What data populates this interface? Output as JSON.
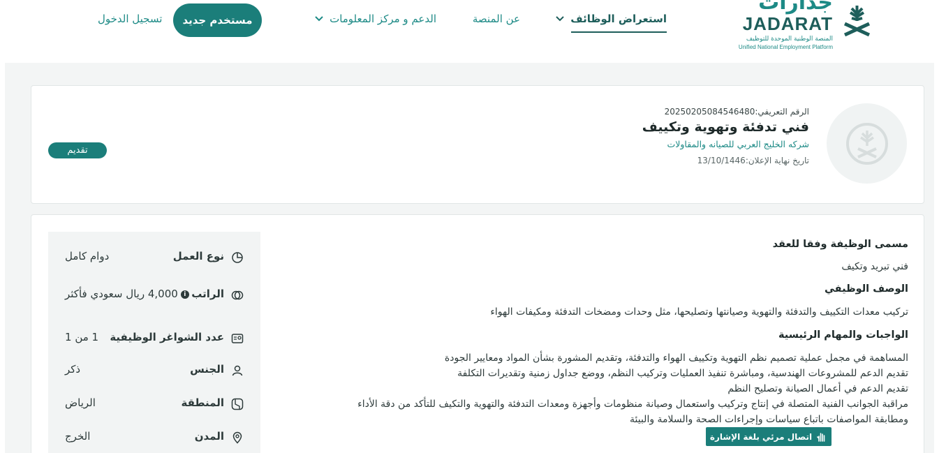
{
  "brand": {
    "name_ar": "جدارات",
    "name_en": "JADARAT",
    "subtitle_ar": "المنصة الوطنية الموحدة للتوظيف",
    "subtitle_en": "Unified National Employment Platform"
  },
  "nav": {
    "browse_jobs": "استعراض الوظائف",
    "about": "عن المنصة",
    "support": "الدعم و مركز المعلومات",
    "new_user": "مستخدم جديد",
    "login": "تسجيل الدخول"
  },
  "job": {
    "id_label": "الرقم التعريفي:",
    "id_value": "20250205084546480",
    "title": "فني تدفئة وتهوية وتكييف",
    "company": "شركه الخليج العربي للصيانه والمقاولات",
    "deadline_label": "تاريخ نهاية الإعلان:",
    "deadline_value": "13/10/1446",
    "apply": "تقديم"
  },
  "details": [
    {
      "icon": "pie-chart-icon",
      "label": "نوع العمل",
      "value": "دوام كامل"
    },
    {
      "icon": "money-icon",
      "label": "الراتب",
      "value": "4,000 ريال سعودي فأكثر"
    },
    {
      "icon": "id-card-icon",
      "label": "عدد الشواغر الوظيفية",
      "value": "1 من 1"
    },
    {
      "icon": "user-icon",
      "label": "الجنس",
      "value": "ذكر"
    },
    {
      "icon": "map-icon",
      "label": "المنطقة",
      "value": "الرياض"
    },
    {
      "icon": "location-pin-icon",
      "label": "المدن",
      "value": "الخرج"
    }
  ],
  "description": {
    "contract_title_heading": "مسمى الوظيفة وفقا للعقد",
    "contract_title": "فني تبريد وتكيف",
    "job_desc_heading": "الوصف الوظيفي",
    "job_desc": "تركيب معدات التكييف والتدفئة والتهوية وصيانتها وتصليحها، مثل وحدات ومضخات التدفئة ومكيفات الهواء",
    "duties_heading": "الواجبات والمهام الرئيسية",
    "duties": [
      "المساهمة في مجمل عملية تصميم نظم التهوية وتكييف الهواء والتدفئة، وتقديم المشورة بشأن المواد ومعايير الجودة",
      "تقديم الدعم للمشروعات الهندسية، ومباشرة تنفيذ العمليات وتركيب النظم، ووضع جداول زمنية وتقديرات التكلفة",
      "تقديم الدعم في أعمال الصيانة وتصليح النظم",
      "مراقبة الجوانب الفنية المتصلة في إنتاج وتركيب واستعمال وصيانة منظومات وأجهزة ومعدات التدفئة والتهوية  والتكيف  للتأكد من دقة الأداء",
      "ومطابقة المواصفات باتباع سياسات وإجراءات الصحة والسلامة والبيئة"
    ]
  },
  "sign_language": "اتصال مرئي بلغة الإشارة",
  "colors": {
    "primary": "#1b7e7a",
    "primary_dark": "#1e5e5b",
    "background": "#f3f5f5"
  }
}
